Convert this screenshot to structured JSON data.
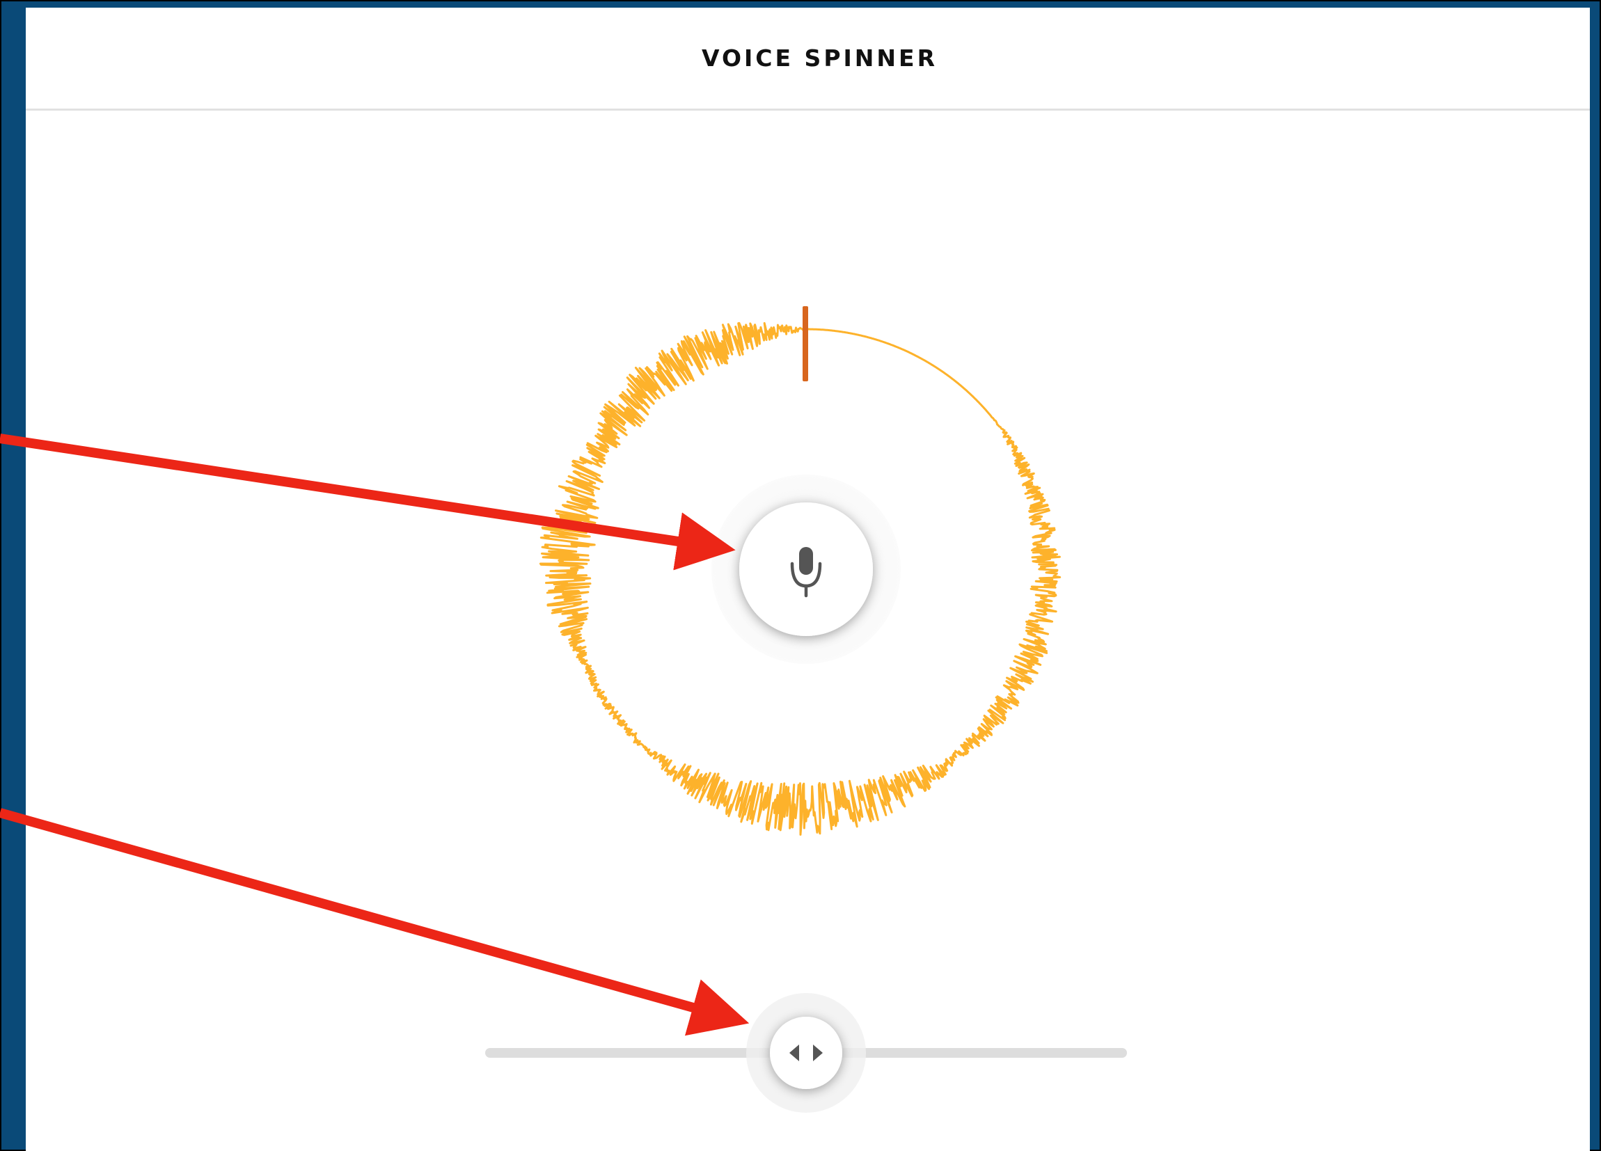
{
  "app": {
    "title": "VOICE SPINNER"
  },
  "colors": {
    "frame_background": "#0a4a78",
    "waveform": "#fdb22b",
    "playhead": "#d8661e",
    "annotation_arrow": "#ec2617",
    "slider_track": "#dddddd",
    "icon": "#555555"
  },
  "icons": {
    "record": "microphone-icon",
    "scrub": "left-right-arrows-icon"
  },
  "slider": {
    "value_fraction": 0.5
  }
}
